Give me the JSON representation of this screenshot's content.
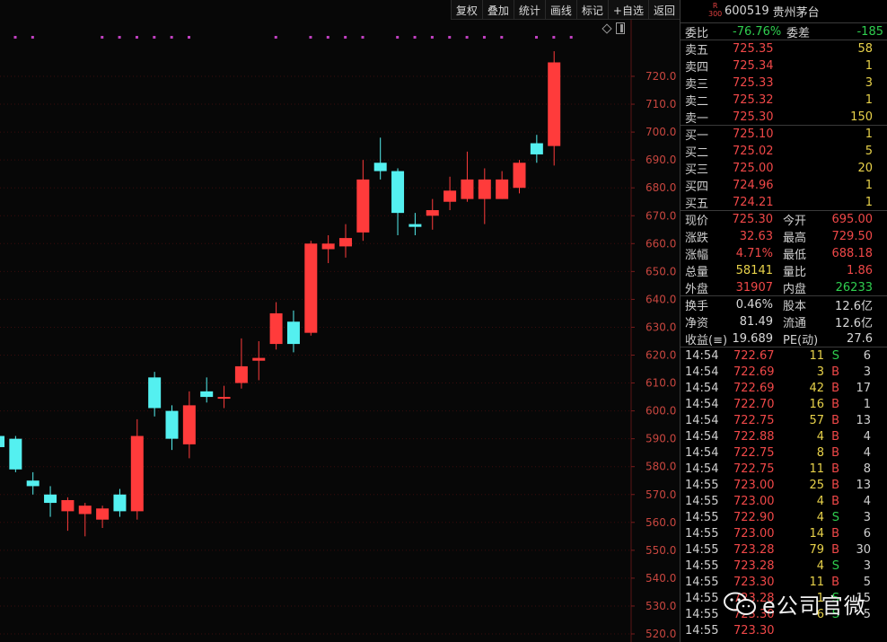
{
  "toolbar": {
    "buttons": [
      "复权",
      "叠加",
      "统计",
      "画线",
      "标记",
      "+自选",
      "返回"
    ]
  },
  "chart_data": {
    "type": "candlestick",
    "yticks": [
      "720.0",
      "710.0",
      "700.0",
      "690.0",
      "680.0",
      "670.0",
      "660.0",
      "650.0",
      "640.0",
      "630.0",
      "620.0",
      "610.0",
      "600.0",
      "590.0",
      "580.0",
      "570.0",
      "560.0",
      "550.0",
      "540.0",
      "530.0",
      "520.0"
    ],
    "ylim": [
      520,
      733
    ],
    "candles": [
      {
        "o": 591,
        "c": 587,
        "h": 592,
        "l": 586
      },
      {
        "o": 590,
        "c": 579,
        "h": 591,
        "l": 578
      },
      {
        "o": 575,
        "c": 573,
        "h": 578,
        "l": 570
      },
      {
        "o": 570,
        "c": 567,
        "h": 573,
        "l": 562
      },
      {
        "o": 564,
        "c": 568,
        "h": 569,
        "l": 557
      },
      {
        "o": 563,
        "c": 566,
        "h": 567,
        "l": 555
      },
      {
        "o": 561,
        "c": 565,
        "h": 566,
        "l": 558
      },
      {
        "o": 570,
        "c": 564,
        "h": 572,
        "l": 562
      },
      {
        "o": 564,
        "c": 591,
        "h": 597,
        "l": 561
      },
      {
        "o": 612,
        "c": 601,
        "h": 614,
        "l": 598
      },
      {
        "o": 600,
        "c": 590,
        "h": 602,
        "l": 586
      },
      {
        "o": 588,
        "c": 602,
        "h": 607,
        "l": 583
      },
      {
        "o": 607,
        "c": 605,
        "h": 612,
        "l": 603
      },
      {
        "o": 605,
        "c": 605,
        "h": 609,
        "l": 601
      },
      {
        "o": 610,
        "c": 616,
        "h": 626,
        "l": 608
      },
      {
        "o": 618,
        "c": 619,
        "h": 625,
        "l": 611
      },
      {
        "o": 624,
        "c": 635,
        "h": 639,
        "l": 622
      },
      {
        "o": 632,
        "c": 624,
        "h": 636,
        "l": 621
      },
      {
        "o": 628,
        "c": 660,
        "h": 661,
        "l": 627
      },
      {
        "o": 658,
        "c": 660,
        "h": 663,
        "l": 653
      },
      {
        "o": 659,
        "c": 662,
        "h": 667,
        "l": 655
      },
      {
        "o": 664,
        "c": 683,
        "h": 690,
        "l": 661
      },
      {
        "o": 689,
        "c": 686,
        "h": 698,
        "l": 683
      },
      {
        "o": 686,
        "c": 671,
        "h": 687,
        "l": 663
      },
      {
        "o": 667,
        "c": 666,
        "h": 671,
        "l": 663
      },
      {
        "o": 670,
        "c": 672,
        "h": 676,
        "l": 665
      },
      {
        "o": 675,
        "c": 679,
        "h": 684,
        "l": 672
      },
      {
        "o": 676,
        "c": 683,
        "h": 693,
        "l": 675
      },
      {
        "o": 676,
        "c": 683,
        "h": 687,
        "l": 667
      },
      {
        "o": 676,
        "c": 683,
        "h": 686,
        "l": 676
      },
      {
        "o": 680,
        "c": 689,
        "h": 690,
        "l": 678
      },
      {
        "o": 696,
        "c": 692,
        "h": 699,
        "l": 689
      },
      {
        "o": 695,
        "c": 725,
        "h": 729,
        "l": 688
      }
    ],
    "marker_count": 33,
    "markers_present": [
      1,
      1,
      0,
      0,
      0,
      1,
      1,
      1,
      1,
      1,
      1,
      0,
      0,
      0,
      0,
      1,
      0,
      1,
      1,
      1,
      1,
      0,
      1,
      1,
      1,
      1,
      1,
      1,
      1,
      0,
      1,
      1,
      1
    ]
  },
  "quote": {
    "badge_r": "R",
    "badge_num": "300",
    "code": "600519",
    "name": "贵州茅台",
    "weibi_label": "委比",
    "weibi_value": "-76.76%",
    "weicha_label": "委差",
    "weicha_value": "-185",
    "asks": [
      {
        "label": "卖五",
        "price": "725.35",
        "vol": "58"
      },
      {
        "label": "卖四",
        "price": "725.34",
        "vol": "1"
      },
      {
        "label": "卖三",
        "price": "725.33",
        "vol": "3"
      },
      {
        "label": "卖二",
        "price": "725.32",
        "vol": "1"
      },
      {
        "label": "卖一",
        "price": "725.30",
        "vol": "150"
      }
    ],
    "bids": [
      {
        "label": "买一",
        "price": "725.10",
        "vol": "1"
      },
      {
        "label": "买二",
        "price": "725.02",
        "vol": "5"
      },
      {
        "label": "买三",
        "price": "725.00",
        "vol": "20"
      },
      {
        "label": "买四",
        "price": "724.96",
        "vol": "1"
      },
      {
        "label": "买五",
        "price": "724.21",
        "vol": "1"
      }
    ],
    "stats1": [
      {
        "l1": "现价",
        "v1": "725.30",
        "c1": "red",
        "l2": "今开",
        "v2": "695.00",
        "c2": "red"
      },
      {
        "l1": "涨跌",
        "v1": "32.63",
        "c1": "red",
        "l2": "最高",
        "v2": "729.50",
        "c2": "red"
      },
      {
        "l1": "涨幅",
        "v1": "4.71%",
        "c1": "red",
        "l2": "最低",
        "v2": "688.18",
        "c2": "red"
      },
      {
        "l1": "总量",
        "v1": "58141",
        "c1": "yellow",
        "l2": "量比",
        "v2": "1.86",
        "c2": "red"
      },
      {
        "l1": "外盘",
        "v1": "31907",
        "c1": "red",
        "l2": "内盘",
        "v2": "26233",
        "c2": "green"
      }
    ],
    "stats2": [
      {
        "l1": "换手",
        "v1": "0.46%",
        "c1": "white",
        "l2": "股本",
        "v2": "12.6亿",
        "c2": "white"
      },
      {
        "l1": "净资",
        "v1": "81.49",
        "c1": "white",
        "l2": "流通",
        "v2": "12.6亿",
        "c2": "white"
      },
      {
        "l1": "收益(≡)",
        "v1": "19.689",
        "c1": "white",
        "l2": "PE(动)",
        "v2": "27.6",
        "c2": "white"
      }
    ],
    "ticks": [
      {
        "t": "14:54",
        "p": "722.67",
        "v": "11",
        "bs": "S",
        "n": "6"
      },
      {
        "t": "14:54",
        "p": "722.69",
        "v": "3",
        "bs": "B",
        "n": "3"
      },
      {
        "t": "14:54",
        "p": "722.69",
        "v": "42",
        "bs": "B",
        "n": "17"
      },
      {
        "t": "14:54",
        "p": "722.70",
        "v": "16",
        "bs": "B",
        "n": "1"
      },
      {
        "t": "14:54",
        "p": "722.75",
        "v": "57",
        "bs": "B",
        "n": "13"
      },
      {
        "t": "14:54",
        "p": "722.88",
        "v": "4",
        "bs": "B",
        "n": "4"
      },
      {
        "t": "14:54",
        "p": "722.75",
        "v": "8",
        "bs": "B",
        "n": "4"
      },
      {
        "t": "14:54",
        "p": "722.75",
        "v": "11",
        "bs": "B",
        "n": "8"
      },
      {
        "t": "14:55",
        "p": "723.00",
        "v": "25",
        "bs": "B",
        "n": "13"
      },
      {
        "t": "14:55",
        "p": "723.00",
        "v": "4",
        "bs": "B",
        "n": "4"
      },
      {
        "t": "14:55",
        "p": "722.90",
        "v": "4",
        "bs": "S",
        "n": "3"
      },
      {
        "t": "14:55",
        "p": "723.00",
        "v": "14",
        "bs": "B",
        "n": "6"
      },
      {
        "t": "14:55",
        "p": "723.28",
        "v": "79",
        "bs": "B",
        "n": "30"
      },
      {
        "t": "14:55",
        "p": "723.28",
        "v": "4",
        "bs": "S",
        "n": "3"
      },
      {
        "t": "14:55",
        "p": "723.30",
        "v": "11",
        "bs": "B",
        "n": "5"
      },
      {
        "t": "14:55",
        "p": "723.28",
        "v": "1",
        "bs": "S",
        "n": "15"
      },
      {
        "t": "14:55",
        "p": "723.30",
        "v": "6",
        "bs": "S",
        "n": "5"
      },
      {
        "t": "14:55",
        "p": "723.30",
        "v": "",
        "bs": "",
        "n": ""
      }
    ]
  },
  "watermark": {
    "text": "e公司官微"
  }
}
